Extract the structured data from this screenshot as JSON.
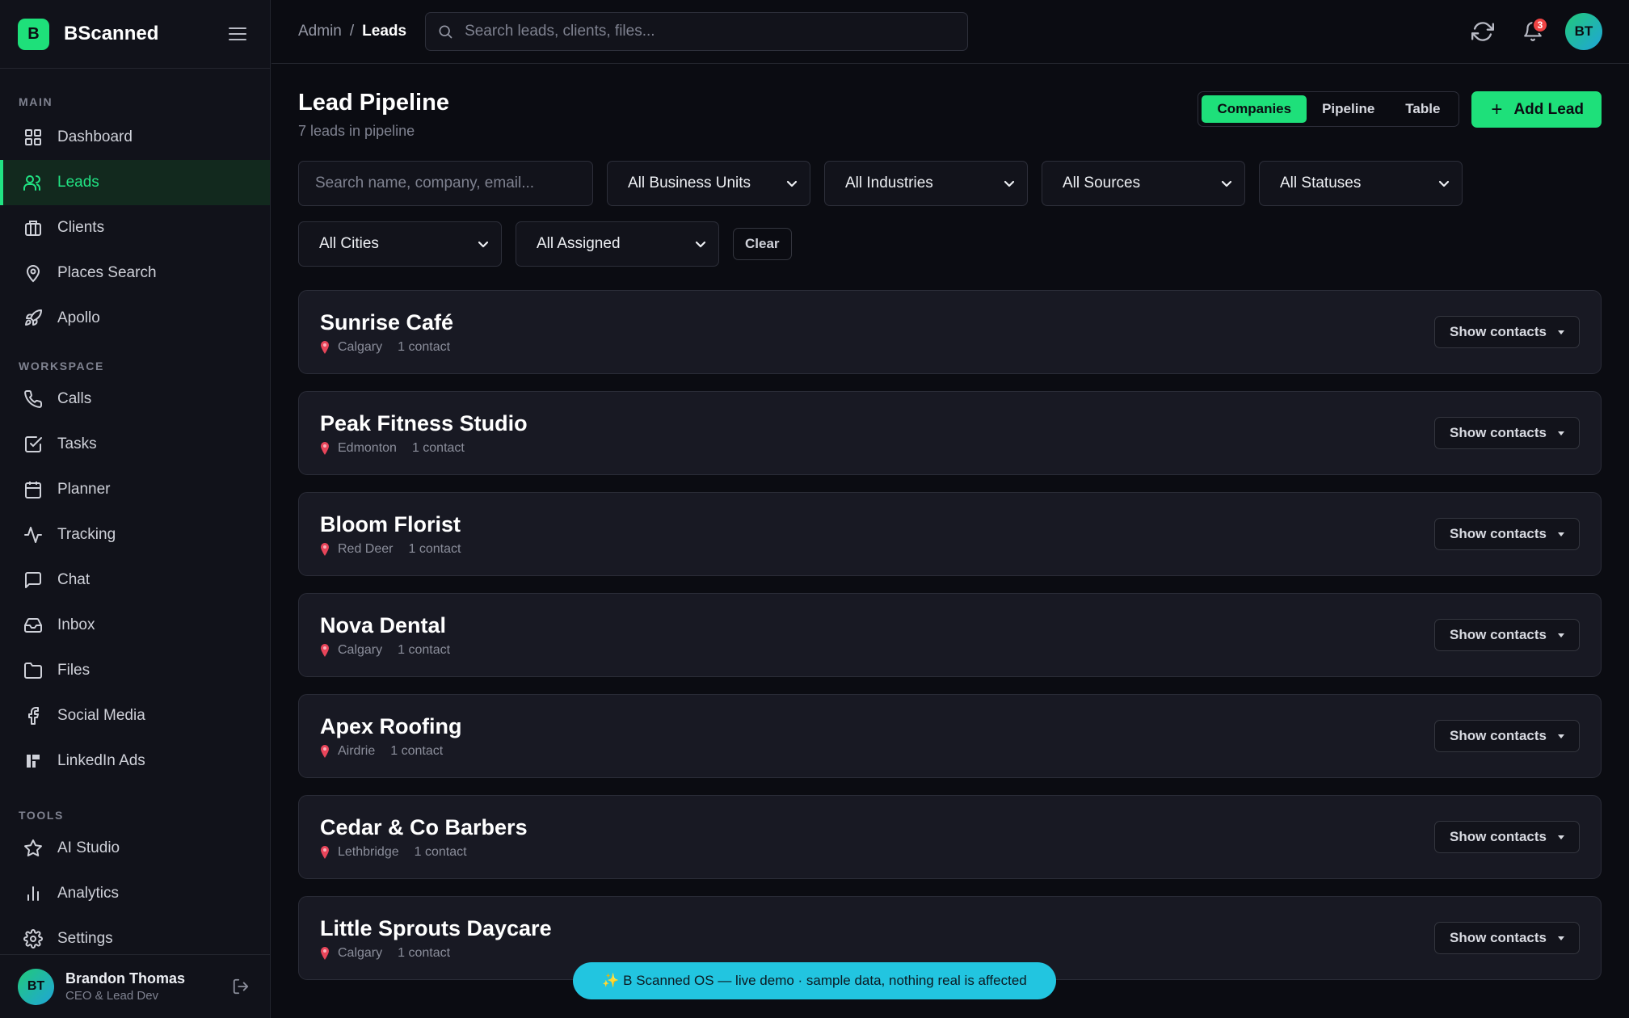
{
  "brand": {
    "logo": "B",
    "name": "BScanned"
  },
  "sidebar": {
    "sections": [
      {
        "label": "MAIN",
        "items": [
          {
            "label": "Dashboard",
            "icon": "grid-icon"
          },
          {
            "label": "Leads",
            "icon": "users-icon",
            "active": true
          },
          {
            "label": "Clients",
            "icon": "briefcase-icon"
          },
          {
            "label": "Places Search",
            "icon": "map-pin-icon"
          },
          {
            "label": "Apollo",
            "icon": "rocket-icon"
          }
        ]
      },
      {
        "label": "WORKSPACE",
        "items": [
          {
            "label": "Calls",
            "icon": "phone-icon"
          },
          {
            "label": "Tasks",
            "icon": "check-square-icon"
          },
          {
            "label": "Planner",
            "icon": "calendar-icon"
          },
          {
            "label": "Tracking",
            "icon": "activity-icon"
          },
          {
            "label": "Chat",
            "icon": "message-icon"
          },
          {
            "label": "Inbox",
            "icon": "inbox-icon"
          },
          {
            "label": "Files",
            "icon": "folder-icon"
          },
          {
            "label": "Social Media",
            "icon": "facebook-icon"
          },
          {
            "label": "LinkedIn Ads",
            "icon": "linkedin-icon"
          }
        ]
      },
      {
        "label": "TOOLS",
        "items": [
          {
            "label": "AI Studio",
            "icon": "star-icon"
          },
          {
            "label": "Analytics",
            "icon": "bar-chart-icon"
          },
          {
            "label": "Settings",
            "icon": "gear-icon"
          }
        ]
      }
    ]
  },
  "user": {
    "initials": "BT",
    "name": "Brandon Thomas",
    "role": "CEO & Lead Dev"
  },
  "topbar": {
    "breadcrumb": {
      "parent": "Admin",
      "separator": "/",
      "current": "Leads"
    },
    "search_placeholder": "Search leads, clients, files...",
    "notifications": "3",
    "avatar": "BT"
  },
  "page": {
    "title": "Lead Pipeline",
    "subtitle": "7 leads in pipeline",
    "views": [
      "Companies",
      "Pipeline",
      "Table"
    ],
    "active_view": "Companies",
    "add_label": "Add Lead"
  },
  "filters": {
    "search_placeholder": "Search name, company, email...",
    "selects": [
      "All Business Units",
      "All Industries",
      "All Sources",
      "All Statuses",
      "All Cities",
      "All Assigned"
    ],
    "clear_label": "Clear"
  },
  "leads": [
    {
      "name": "Sunrise Café",
      "city": "Calgary",
      "contacts": "1 contact"
    },
    {
      "name": "Peak Fitness Studio",
      "city": "Edmonton",
      "contacts": "1 contact"
    },
    {
      "name": "Bloom Florist",
      "city": "Red Deer",
      "contacts": "1 contact"
    },
    {
      "name": "Nova Dental",
      "city": "Calgary",
      "contacts": "1 contact"
    },
    {
      "name": "Apex Roofing",
      "city": "Airdrie",
      "contacts": "1 contact"
    },
    {
      "name": "Cedar & Co Barbers",
      "city": "Lethbridge",
      "contacts": "1 contact"
    },
    {
      "name": "Little Sprouts Daycare",
      "city": "Calgary",
      "contacts": "1 contact"
    }
  ],
  "show_contacts_label": "Show contacts",
  "toast": "✨ B Scanned OS — live demo · sample data, nothing real is affected",
  "colors": {
    "accent": "#1ee07a",
    "background": "#0b0c12",
    "toast": "#22c5e0",
    "badge": "#ef4444"
  }
}
